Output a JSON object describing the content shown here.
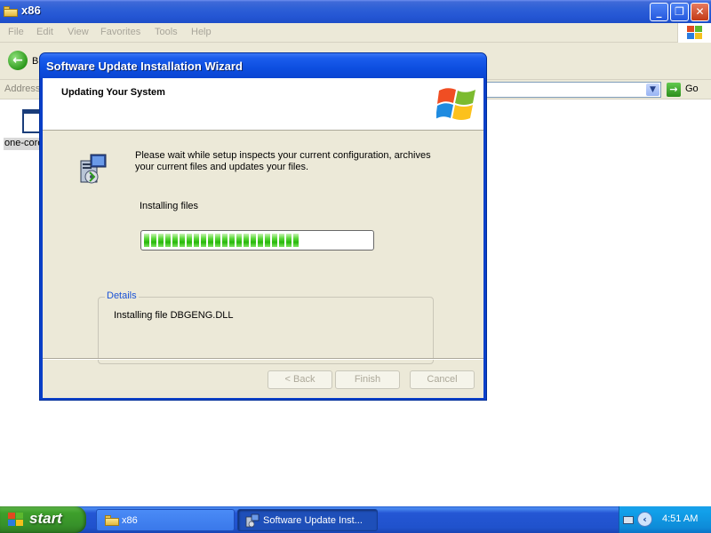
{
  "explorer": {
    "title": "x86",
    "menu": [
      "File",
      "Edit",
      "View",
      "Favorites",
      "Tools",
      "Help"
    ],
    "toolbar": {
      "back_label": "B"
    },
    "address": {
      "label": "Address",
      "go_label": "Go"
    },
    "file": {
      "name": "one-core"
    },
    "window_buttons": {
      "minimize": "_",
      "restore": "❐",
      "close": "✕"
    }
  },
  "wizard": {
    "title": "Software Update Installation Wizard",
    "header_title": "Updating Your System",
    "description": "Please wait while setup inspects your current configuration, archives your current files and updates your files.",
    "status": "Installing files",
    "progress_fraction": 0.69,
    "details_label": "Details",
    "details_text": "Installing file DBGENG.DLL",
    "buttons": {
      "back": "< Back",
      "finish": "Finish",
      "cancel": "Cancel"
    }
  },
  "taskbar": {
    "start_label": "start",
    "tasks": [
      {
        "label": "x86",
        "icon": "folder-icon",
        "active": false
      },
      {
        "label": "Software Update Inst...",
        "icon": "setup-icon",
        "active": true
      }
    ],
    "clock": "4:51 AM"
  },
  "colors": {
    "title_blue": "#2456d4",
    "dialog_face": "#ece9d8",
    "progress_green": "#27b80a",
    "details_label_blue": "#1b53d6",
    "start_green": "#3e9f2b"
  }
}
